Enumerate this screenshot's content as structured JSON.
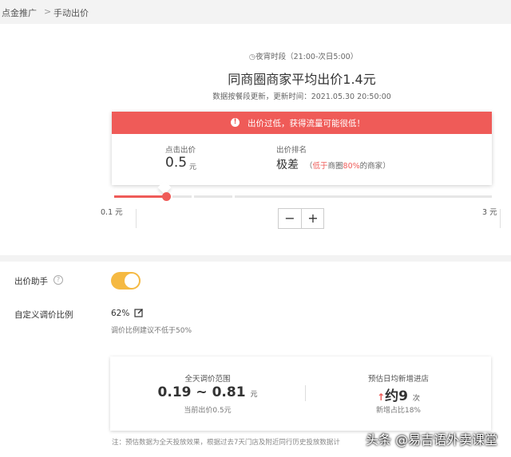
{
  "breadcrumb": {
    "parent": "点金推广",
    "separator": ">",
    "current": "手动出价"
  },
  "header": {
    "period": "夜宵时段（21:00-次日5:00）",
    "headline": "同商圈商家平均出价1.4元",
    "updated": "数据按餐段更新，更新时间：2021.05.30 20:50:00"
  },
  "alert": {
    "icon": "alert-icon",
    "text": "出价过低，获得流量可能很低！"
  },
  "bid": {
    "label": "点击出价",
    "value": "0.5",
    "unit": "元"
  },
  "rank": {
    "label": "出价排名",
    "value": "极差",
    "open": "（",
    "prefix": "低于",
    "mid": "商圈",
    "percent": "80%",
    "suffix": "的商家",
    "close": "）"
  },
  "slider": {
    "min_label": "0.1 元",
    "max_label": "3 元",
    "min": 0.1,
    "max": 3,
    "value": 0.5
  },
  "stepper": {
    "minus": "−",
    "plus": "+"
  },
  "assistant": {
    "label": "出价助手",
    "help": "?",
    "enabled": true
  },
  "ratio": {
    "label": "自定义调价比例",
    "value": "62%",
    "hint": "调价比例建议不低于50%"
  },
  "summary": {
    "range": {
      "label": "全天调价范围",
      "low": "0.19",
      "sep": "~",
      "high": "0.81",
      "unit": "元",
      "sub": "当前出价0.5元"
    },
    "growth": {
      "label": "预估日均新增进店",
      "arrow": "↑",
      "value": "约9",
      "unit": "次",
      "sub": "新增占比18%"
    }
  },
  "footnote": "注：预估数据为全天投放效果，根据过去7天门店及附近同行历史投放数据计",
  "watermark": "头条 @易吉语外卖课堂",
  "colors": {
    "accent_red": "#ef5b58",
    "toggle_on": "#f5b942"
  }
}
